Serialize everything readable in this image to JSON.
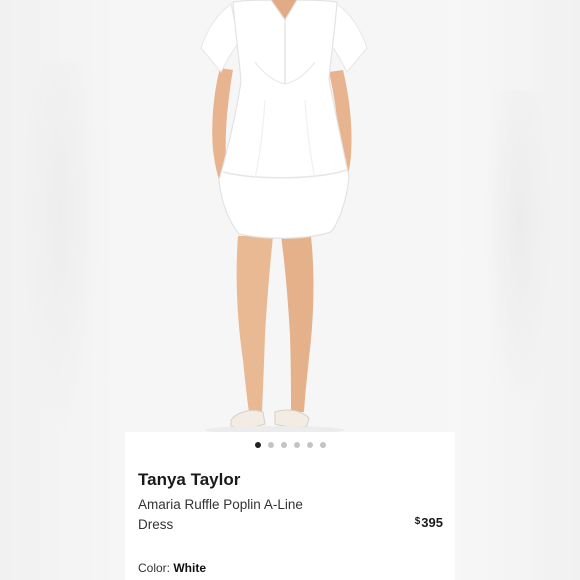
{
  "product": {
    "brand": "Tanya Taylor",
    "name": "Amaria Ruffle Poplin A-Line Dress",
    "price_currency": "$",
    "price_amount": "395",
    "color_label": "Color:",
    "color_value": "White"
  },
  "gallery": {
    "image_count": 6,
    "active_index": 0
  },
  "colors": {
    "page_bg": "#f3f3f3",
    "card_bg": "#ffffff",
    "dot_active": "#222222",
    "dot_inactive": "#c4c4c4"
  }
}
